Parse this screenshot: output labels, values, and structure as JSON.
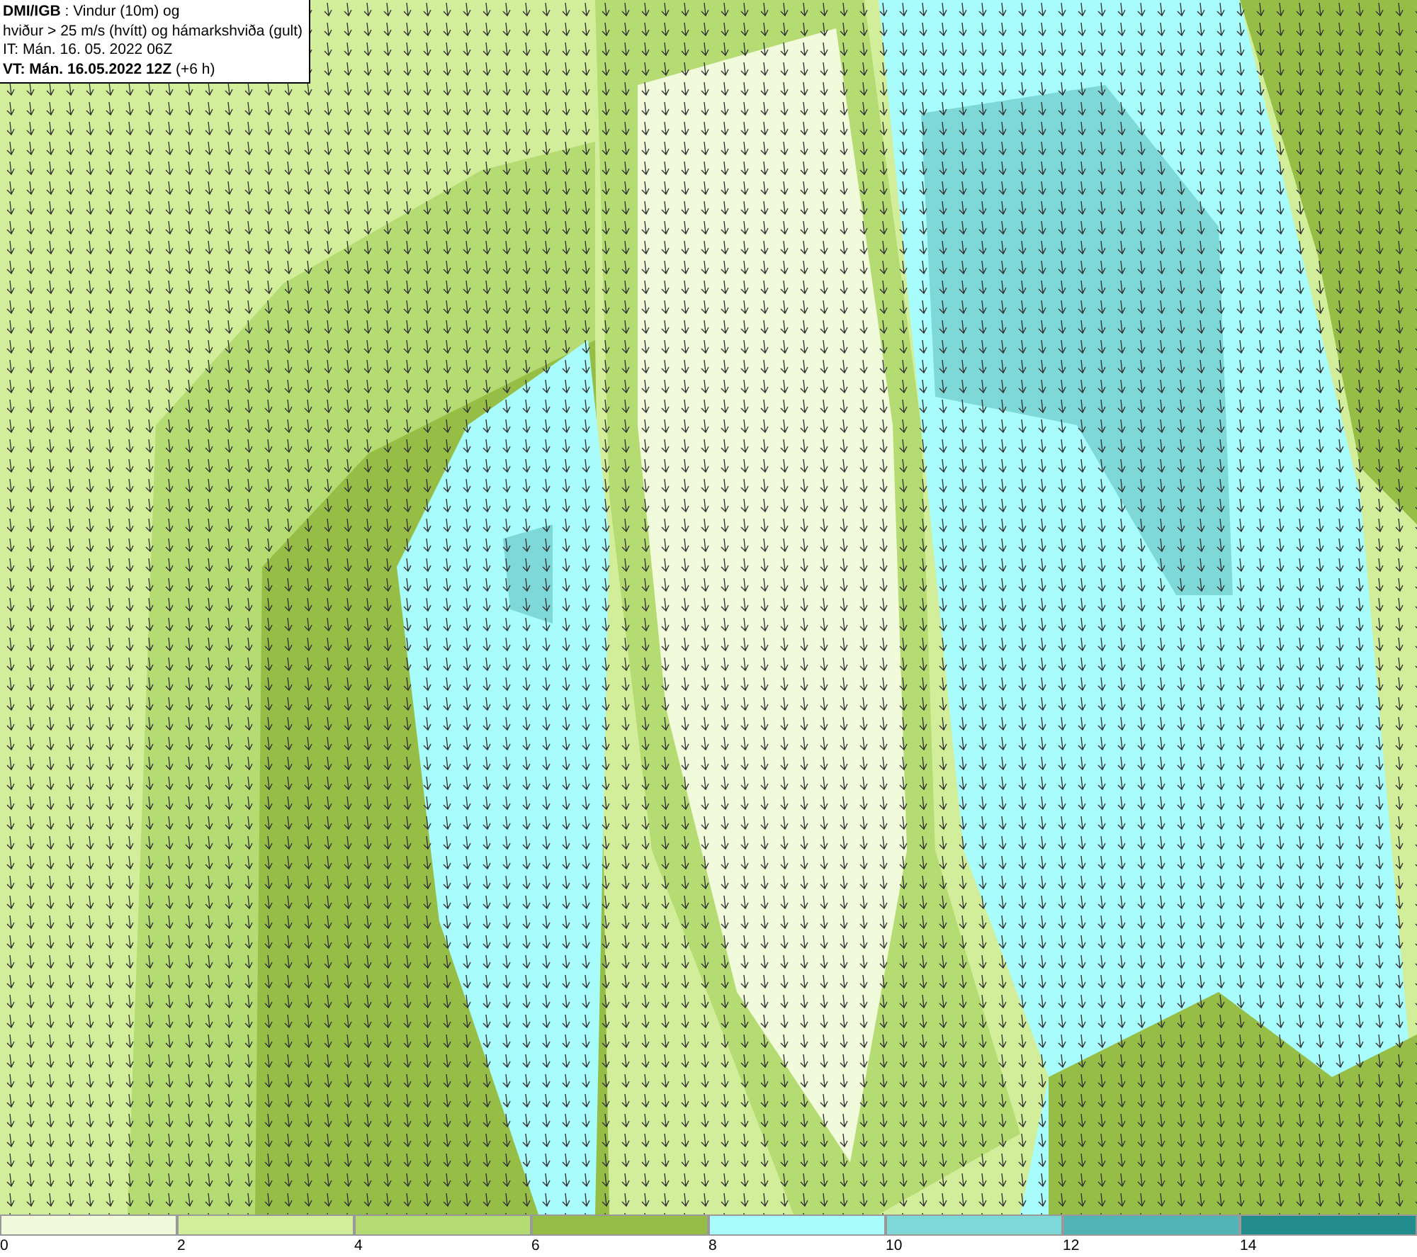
{
  "info_box": {
    "lines": [
      "**DMI/IGB** : Vindur (10m) og",
      "hviður > 25 m/s (hvítt) og hámarkshviða (gult)",
      "IT: Mán. 16. 05. 2022 06Z",
      "**VT: Mán. 16.05.2022 12Z** (+6 h)"
    ]
  },
  "legend": [
    {
      "label": "0",
      "color": "#f2fadc"
    },
    {
      "label": "2",
      "color": "#d3ee9a"
    },
    {
      "label": "4",
      "color": "#b4dc72"
    },
    {
      "label": "6",
      "color": "#96be46"
    },
    {
      "label": "8",
      "color": "#a8fcfc"
    },
    {
      "label": "10",
      "color": "#7ed8d8"
    },
    {
      "label": "12",
      "color": "#52b4b4"
    },
    {
      "label": "14",
      "color": "#228c8c"
    }
  ]
}
